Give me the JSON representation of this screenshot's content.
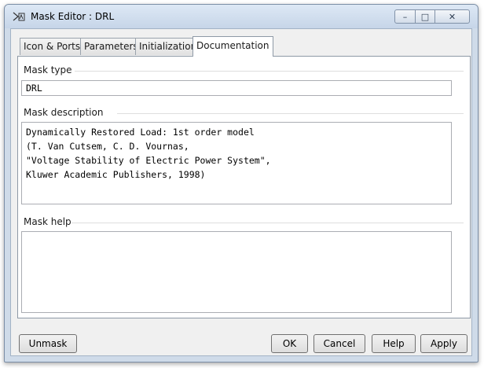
{
  "window": {
    "title": "Mask Editor : DRL",
    "controls": {
      "minimize": "–",
      "maximize": "□",
      "close": "✕"
    }
  },
  "tabs": [
    {
      "label": "Icon & Ports",
      "active": false
    },
    {
      "label": "Parameters",
      "active": false
    },
    {
      "label": "Initialization",
      "active": false
    },
    {
      "label": "Documentation",
      "active": true
    }
  ],
  "documentation": {
    "mask_type": {
      "label": "Mask type",
      "value": "DRL"
    },
    "mask_description": {
      "label": "Mask description",
      "lines": [
        "Dynamically Restored Load: 1st order model",
        "(T. Van Cutsem, C. D. Vournas,",
        "\"Voltage Stability of Electric Power System\",",
        "Kluwer Academic Publishers, 1998)"
      ]
    },
    "mask_help": {
      "label": "Mask help",
      "value": ""
    }
  },
  "buttons": {
    "unmask": "Unmask",
    "ok": "OK",
    "cancel": "Cancel",
    "help": "Help",
    "apply": "Apply"
  }
}
